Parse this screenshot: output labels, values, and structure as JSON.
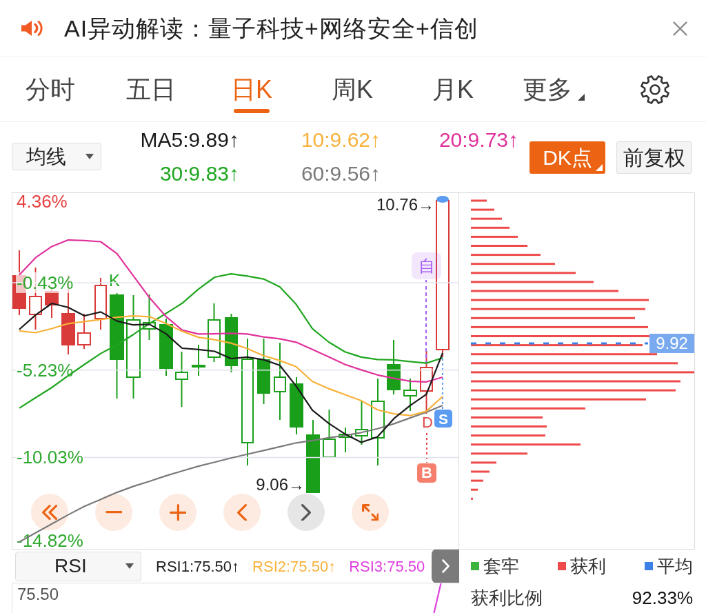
{
  "banner": {
    "title": "AI异动解读：量子科技+网络安全+信创"
  },
  "tabs": [
    {
      "label": "分时",
      "selected": false,
      "kind": "plain"
    },
    {
      "label": "五日",
      "selected": false,
      "kind": "plain"
    },
    {
      "label": "日K",
      "selected": true,
      "kind": "plain"
    },
    {
      "label": "周K",
      "selected": false,
      "kind": "plain"
    },
    {
      "label": "月K",
      "selected": false,
      "kind": "plain"
    },
    {
      "label": "更多",
      "selected": false,
      "kind": "dropdown"
    }
  ],
  "indicator_select": {
    "value": "均线"
  },
  "option_buttons": [
    {
      "label": "DK点",
      "selected": true,
      "kind": "dropdown"
    },
    {
      "label": "前复权",
      "selected": false,
      "kind": "plain"
    }
  ],
  "chart": {
    "chart_data": {
      "type": "line",
      "categories": [
        null,
        null,
        null,
        null,
        null,
        null,
        null,
        null,
        null,
        null,
        null,
        null,
        null,
        null,
        null,
        null,
        null,
        null,
        null,
        null,
        null,
        null,
        null,
        null,
        null,
        null,
        null
      ],
      "ylim": [
        -15.05,
        4.49
      ],
      "yticks": [
        {
          "value": 4.36,
          "label": "4.36%"
        },
        {
          "value": -0.43,
          "label": "-0.43%"
        },
        {
          "value": -5.23,
          "label": "-5.23%"
        },
        {
          "value": -10.03,
          "label": "-10.03%"
        },
        {
          "value": -14.82,
          "label": "-14.82%"
        }
      ],
      "grid": true,
      "series": [
        {
          "name": "MA5:9.89↑",
          "color": "#1a1a1a",
          "values": [
            -3.0,
            -2.21,
            -1.57,
            -1.79,
            -2.25,
            -2.04,
            -2.54,
            -2.75,
            -2.72,
            -3.23,
            -4.03,
            -4.1,
            -4.2,
            -4.6,
            -4.52,
            -4.66,
            -4.97,
            -6.11,
            -7.43,
            -8.15,
            -8.74,
            -9.2,
            -8.9,
            -7.9,
            -7.18,
            -6.56,
            -4.29
          ]
        },
        {
          "name": "10:9.62↑",
          "color": "#f8b13a",
          "values": [
            -3.08,
            -3.18,
            -2.95,
            -2.68,
            -2.57,
            -2.45,
            -2.33,
            -2.26,
            -2.3,
            -2.67,
            -3.1,
            -3.43,
            -3.56,
            -3.75,
            -4.05,
            -4.44,
            -4.71,
            -5.04,
            -5.86,
            -6.25,
            -6.58,
            -6.91,
            -7.41,
            -7.63,
            -7.73,
            -7.49,
            -6.68
          ]
        },
        {
          "name": "20:9.73↑",
          "color": "#e0329b",
          "values": [
            -0.01,
            0.94,
            1.56,
            1.91,
            1.88,
            1.82,
            1.16,
            -0.05,
            -1.26,
            -2.28,
            -3.03,
            -3.25,
            -3.24,
            -3.21,
            -3.25,
            -3.41,
            -3.51,
            -3.7,
            -4.1,
            -4.5,
            -4.92,
            -5.22,
            -5.5,
            -5.68,
            -5.84,
            -5.88,
            -5.62
          ]
        },
        {
          "name": "30:9.83↑",
          "color": "#1fa61f",
          "values": [
            -7.32,
            -6.75,
            -6.19,
            -5.54,
            -4.92,
            -4.32,
            -3.85,
            -3.28,
            -2.68,
            -2.13,
            -1.56,
            -0.79,
            -0.13,
            0.05,
            -0.07,
            -0.23,
            -0.66,
            -1.62,
            -2.96,
            -3.69,
            -4.23,
            -4.52,
            -4.65,
            -4.67,
            -4.76,
            -4.85,
            -4.56
          ]
        },
        {
          "name": "60:9.56↑",
          "color": "#7a7a7a",
          "values": [
            -14.67,
            -14.17,
            -13.68,
            -13.18,
            -12.71,
            -12.33,
            -11.95,
            -11.62,
            -11.34,
            -11.04,
            -10.77,
            -10.51,
            -10.29,
            -10.06,
            -9.85,
            -9.65,
            -9.44,
            -9.23,
            -9.1,
            -8.95,
            -8.82,
            -8.66,
            -8.45,
            -8.18,
            -7.86,
            -7.54,
            -7.17
          ]
        }
      ]
    },
    "k_label": "K",
    "high_label": "10.76→",
    "low_label": "9.06→",
    "markers": [
      {
        "text": "自",
        "kind": "tinted",
        "color": "#a55ef2"
      },
      {
        "text": "D",
        "kind": "outline",
        "color": "#e04848"
      },
      {
        "text": "S",
        "kind": "filled",
        "color": "#5b9cf2"
      },
      {
        "text": "B",
        "kind": "filled",
        "color": "#f57e6c"
      }
    ],
    "nav_buttons": [
      {
        "kind": "first",
        "disabled": false
      },
      {
        "kind": "zoom-out",
        "disabled": false
      },
      {
        "kind": "zoom-in",
        "disabled": false
      },
      {
        "kind": "prev",
        "disabled": false
      },
      {
        "kind": "next",
        "disabled": true
      },
      {
        "kind": "fullscreen",
        "disabled": false
      }
    ]
  },
  "rsi": {
    "select": "RSI",
    "values": [
      {
        "text": "RSI1:75.50↑",
        "color": "#222222"
      },
      {
        "text": "RSI2:75.50↑",
        "color": "#f8b13a"
      },
      {
        "text": "RSI3:75.50",
        "color": "#e040e0"
      }
    ],
    "axis_label": "75.50"
  },
  "chip_panel": {
    "average_label": "9.92",
    "legend": [
      {
        "label": "套牢",
        "color": "#3cb43c"
      },
      {
        "label": "获利",
        "color": "#ee4a4a"
      },
      {
        "label": "平均",
        "color": "#3a80e6"
      }
    ],
    "ratio_label": "获利比例",
    "ratio_value": "92.33%"
  }
}
